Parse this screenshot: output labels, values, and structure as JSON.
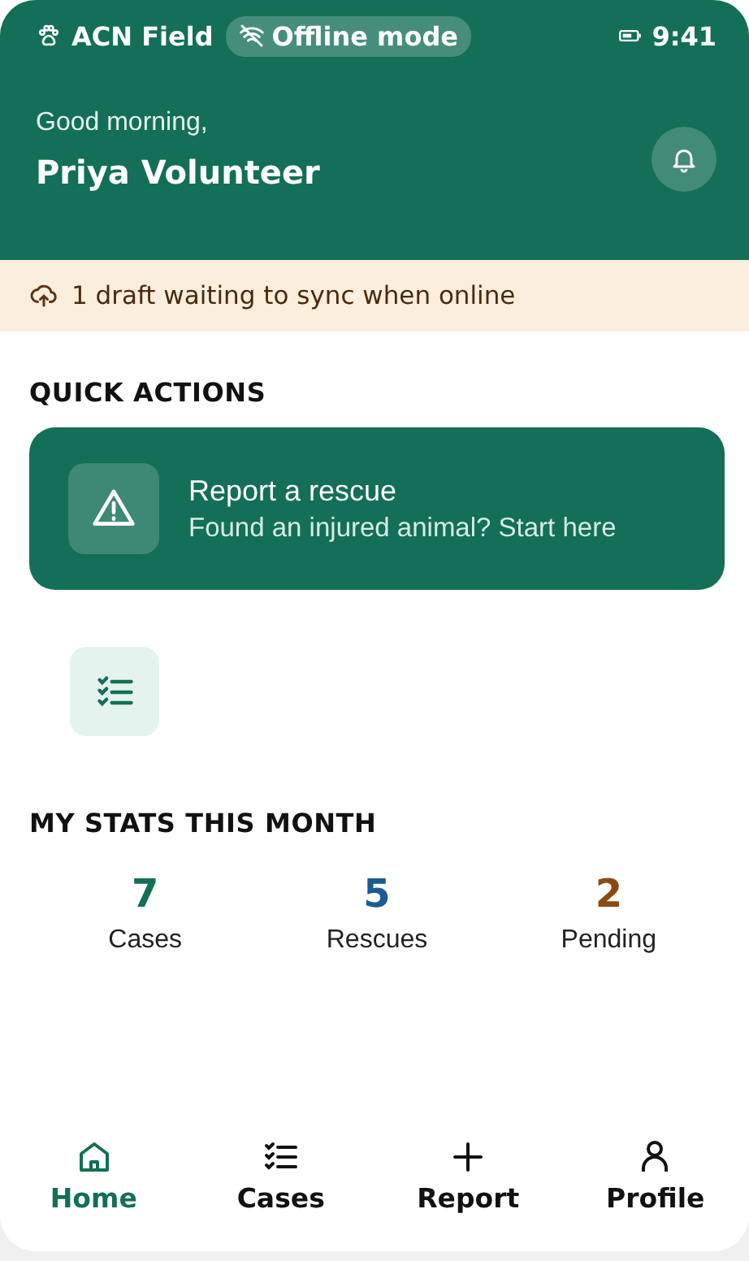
{
  "status_bar": {
    "app_name": "ACN Field",
    "badge": "Offline mode",
    "time": "9:41"
  },
  "header": {
    "greeting": "Good morning,",
    "name": "Priya Volunteer"
  },
  "sync_banner": {
    "text": "1 draft waiting to sync when online"
  },
  "quick_actions": {
    "title": "QUICK ACTIONS",
    "primary": {
      "title": "Report a rescue",
      "subtitle": "Found an injured animal? Start here"
    },
    "tiles": [
      {
        "kind": "checklist"
      }
    ]
  },
  "stats": {
    "title": "MY STATS THIS MONTH",
    "items": [
      {
        "value": "7",
        "label": "Cases",
        "color": "#136f57"
      },
      {
        "value": "5",
        "label": "Rescues",
        "color": "#1c5a94"
      },
      {
        "value": "2",
        "label": "Pending",
        "color": "#8a4a12"
      }
    ]
  },
  "nav": [
    {
      "kind": "home",
      "label": "Home",
      "selected": true
    },
    {
      "kind": "cases",
      "label": "Cases",
      "selected": false
    },
    {
      "kind": "report",
      "label": "Report",
      "selected": false
    },
    {
      "kind": "profile",
      "label": "Profile",
      "selected": false
    }
  ]
}
